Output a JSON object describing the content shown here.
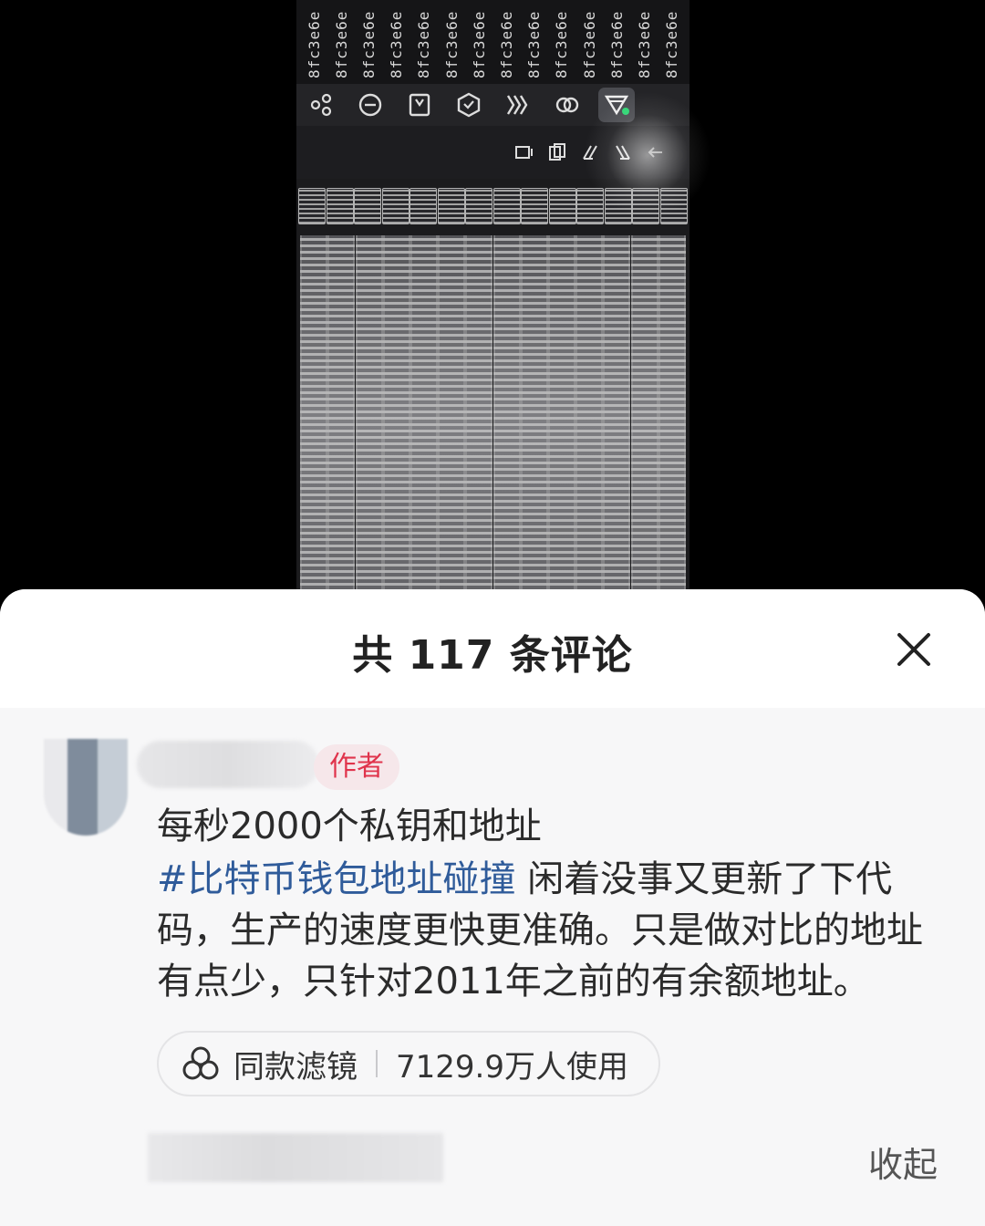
{
  "video": {
    "hex_columns": [
      "8fc3e6e",
      "8fc3e6e",
      "8fc3e6e",
      "8fc3e6e",
      "8fc3e6e",
      "8fc3e6e",
      "8fc3e6e",
      "8fc3e6e",
      "8fc3e6e",
      "8fc3e6e",
      "8fc3e6e",
      "8fc3e6e",
      "8fc3e6e",
      "8fc3e6e"
    ],
    "toolbar_icons": [
      "share-nodes-icon",
      "minus-circle-icon",
      "document-icon",
      "shield-icon",
      "wave-icon",
      "link-icon",
      "filter-funnel-icon"
    ],
    "small_icons": [
      "pause-lines-icon",
      "copy-icon",
      "tilt-left-icon",
      "tilt-right-icon",
      "back-arrow-icon"
    ]
  },
  "sheet": {
    "title": "共 117 条评论"
  },
  "comment": {
    "badge": "作者",
    "line1": "每秒2000个私钥和地址",
    "hashtag": "#比特币钱包地址碰撞",
    "body": " 闲着没事又更新了下代码，生产的速度更快更准确。只是做对比的地址有点少，只针对2011年之前的有余额地址。",
    "filter_label": "同款滤镜",
    "filter_usage": "7129.9万人使用",
    "collapse": "收起"
  },
  "colors": {
    "hashtag": "#2f5b9a",
    "badge_text": "#e0344c",
    "badge_bg": "#f6e7ea",
    "active_dot": "#2ed573"
  }
}
